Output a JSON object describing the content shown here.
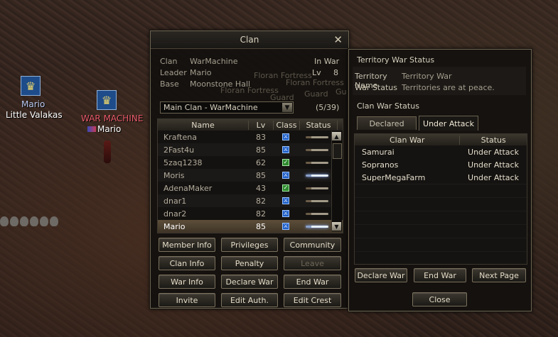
{
  "world": {
    "player1": {
      "name": "Mario",
      "title": "Little Valakas"
    },
    "player2": {
      "clan": "WAR MACHINE",
      "name": "Mario"
    }
  },
  "clan_window": {
    "title": "Clan",
    "clan_label": "Clan",
    "clan_value": "WarMachine",
    "war_state": "In War",
    "leader_label": "Leader",
    "leader_value": "Mario",
    "lv_label": "Lv",
    "lv_value": "8",
    "base_label": "Base",
    "base_value": "Moonstone Hall",
    "ghost_texts": [
      "Floran Fortress",
      "Floran Fortress",
      "Guard",
      "Guard",
      "Floran Fortress",
      "Gu"
    ],
    "select_value": "Main Clan - WarMachine",
    "member_count": "(5/39)",
    "columns": [
      "Name",
      "Lv",
      "Class",
      "Status"
    ],
    "members": [
      {
        "name": "Kraftena",
        "lv": "83",
        "class": "blue",
        "online": false
      },
      {
        "name": "2Fast4u",
        "lv": "85",
        "class": "blue",
        "online": false
      },
      {
        "name": "5zaq1238",
        "lv": "62",
        "class": "green",
        "online": false
      },
      {
        "name": "Moris",
        "lv": "85",
        "class": "blue",
        "online": true
      },
      {
        "name": "AdenaMaker",
        "lv": "43",
        "class": "green",
        "online": false
      },
      {
        "name": "dnar1",
        "lv": "82",
        "class": "blue",
        "online": false
      },
      {
        "name": "dnar2",
        "lv": "82",
        "class": "blue",
        "online": false
      },
      {
        "name": "Mario",
        "lv": "85",
        "class": "blue",
        "online": true
      }
    ],
    "buttons": [
      "Member Info",
      "Privileges",
      "Community",
      "Clan Info",
      "Penalty",
      "Leave",
      "War Info",
      "Declare War",
      "End War",
      "Invite",
      "Edit Auth.",
      "Edit Crest"
    ]
  },
  "territory_window": {
    "title": "Territory War Status",
    "name_label": "Territory Name",
    "name_value": "Territory War",
    "status_label": "War Status",
    "status_value": "Territories are at peace.",
    "clan_war_title": "Clan War Status",
    "tabs": [
      "Declared",
      "Under Attack"
    ],
    "columns": [
      "Clan War",
      "Status"
    ],
    "wars": [
      {
        "clan": "Samurai",
        "status": "Under Attack"
      },
      {
        "clan": "Sopranos",
        "status": "Under Attack"
      },
      {
        "clan": "SuperMegaFarm",
        "status": "Under Attack"
      }
    ],
    "buttons": [
      "Declare War",
      "End War",
      "Next Page"
    ],
    "close": "Close"
  },
  "colors": {
    "clan_name": "#e85a6a",
    "player_name": "#b9c8f0",
    "accent": "#6b6250"
  }
}
